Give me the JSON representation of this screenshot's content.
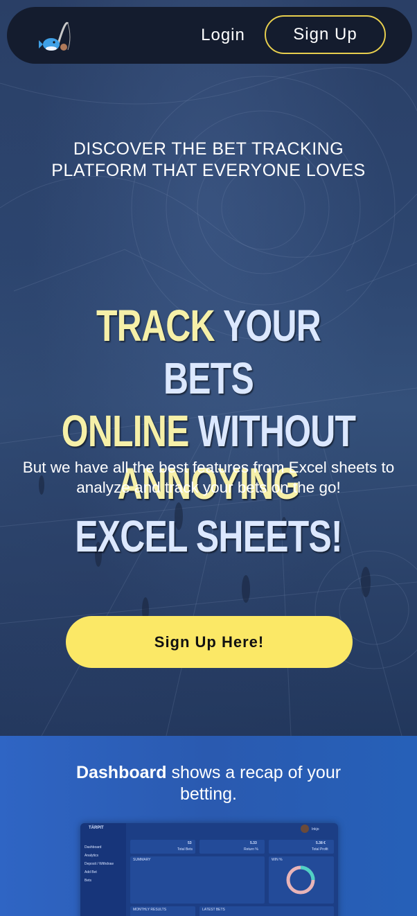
{
  "nav": {
    "logo_alt": "fishing-logo",
    "login_label": "Login",
    "signup_label": "Sign Up"
  },
  "hero": {
    "tagline": "DISCOVER THE BET TRACKING PLATFORM THAT EVERYONE LOVES",
    "headline_line1_a": "TRACK",
    "headline_line1_b": " YOUR BETS",
    "headline_line2_a": "ONLINE",
    "headline_line2_b": " WITHOUT",
    "headline_line3_a": "ANNOYING",
    "headline_line3_b": " EXCEL SHEETS!",
    "subtext": "But we have all the best features from Excel sheets to analyze and track your bets on the go!",
    "cta_label": "Sign Up Here!"
  },
  "feature": {
    "title_bold": "Dashboard",
    "title_rest": " shows a recap of your betting.",
    "screenshot": {
      "brand": "TÄRPIT",
      "user": "Inkjo",
      "menu": [
        "Dashboard",
        "Analytics",
        "Deposit / Withdraw",
        "Add Bet",
        "Bets"
      ],
      "stat1_value": "53",
      "stat1_label": "Total Bets",
      "stat2_value": "5.33",
      "stat2_label": "Return %",
      "stat3_value": "5.38 €",
      "stat3_label": "Total Profit",
      "summary_label": "SUMMARY",
      "win_label": "WIN %",
      "monthly_label": "MONTHLY RESULTS",
      "latest_label": "LATEST BETS"
    }
  },
  "colors": {
    "nav_bg": "#141c2e",
    "accent_yellow": "#fbe866",
    "signup_border": "#e8cf4e",
    "feature_bg": "#2a5ab0"
  }
}
